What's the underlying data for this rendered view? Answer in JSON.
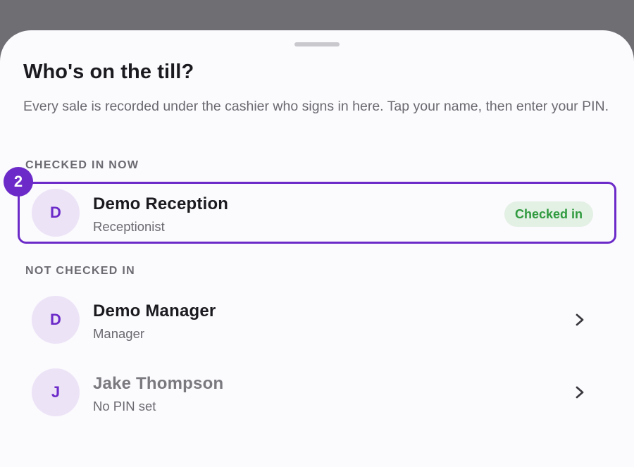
{
  "sheet": {
    "title": "Who's on the till?",
    "subtitle": "Every sale is recorded under the cashier who signs in here. Tap your name, then enter your PIN."
  },
  "sections": {
    "checked_in_label": "CHECKED IN NOW",
    "not_checked_in_label": "NOT CHECKED IN"
  },
  "checked_in": [
    {
      "initial": "D",
      "name": "Demo Reception",
      "role": "Receptionist",
      "status": "Checked in"
    }
  ],
  "not_checked_in": [
    {
      "initial": "D",
      "name": "Demo Manager",
      "role": "Manager"
    },
    {
      "initial": "J",
      "name": "Jake Thompson",
      "role": "No PIN set"
    }
  ],
  "step_marker": "2",
  "colors": {
    "accent": "#6c2bc9",
    "avatar_bg": "#ece3f7",
    "status_bg": "#e3f0e4",
    "status_text": "#2f9a3e",
    "sheet_bg": "#fbfafd",
    "backdrop": "#6f6e73"
  },
  "icons": {
    "row_action": "chevron-right-icon"
  }
}
